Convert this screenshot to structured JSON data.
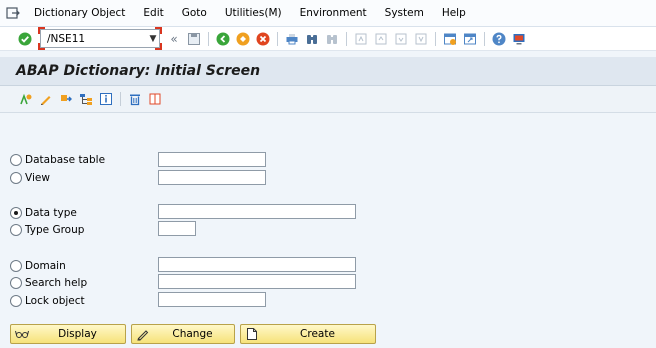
{
  "menu": {
    "items": [
      {
        "label": "Dictionary Object"
      },
      {
        "label": "Edit"
      },
      {
        "label": "Goto"
      },
      {
        "label": "Utilities(M)"
      },
      {
        "label": "Environment"
      },
      {
        "label": "System"
      },
      {
        "label": "Help"
      }
    ]
  },
  "toolbar": {
    "command_value": "/NSE11"
  },
  "title": "ABAP Dictionary: Initial Screen",
  "form": {
    "options": [
      {
        "label": "Database table",
        "selected": false
      },
      {
        "label": "View",
        "selected": false
      },
      {
        "label": "Data type",
        "selected": true
      },
      {
        "label": "Type Group",
        "selected": false
      },
      {
        "label": "Domain",
        "selected": false
      },
      {
        "label": "Search help",
        "selected": false
      },
      {
        "label": "Lock object",
        "selected": false
      }
    ]
  },
  "buttons": {
    "display": "Display",
    "change": "Change",
    "create": "Create"
  },
  "colors": {
    "button_fill": "#f6e27a",
    "title_bg": "#dfe7f0",
    "command_focus": "#d9351f"
  }
}
